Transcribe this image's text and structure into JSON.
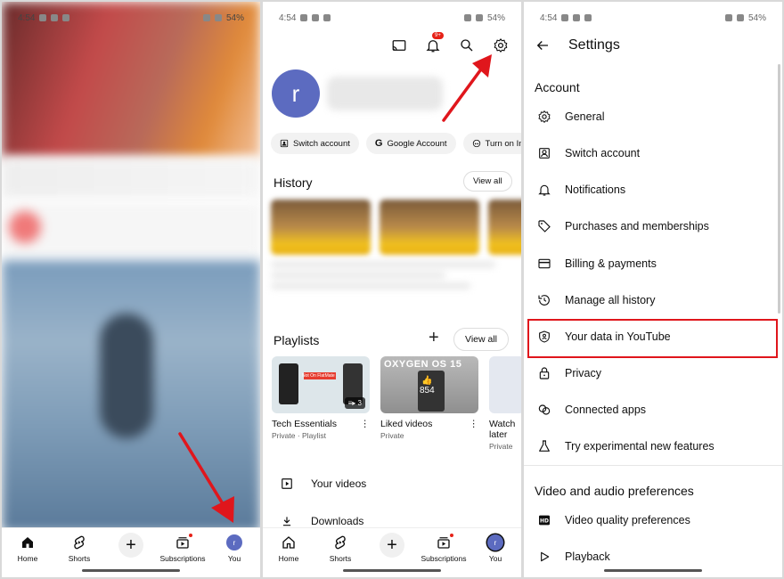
{
  "status_bar": {
    "time": "4:54",
    "battery": "54%"
  },
  "panel1": {
    "nav": [
      {
        "label": "Home",
        "icon": "home-icon"
      },
      {
        "label": "Shorts",
        "icon": "shorts-icon"
      },
      {
        "label": "",
        "icon": "plus-icon"
      },
      {
        "label": "Subscriptions",
        "icon": "subscriptions-icon"
      },
      {
        "label": "You",
        "icon": "avatar"
      }
    ]
  },
  "panel2": {
    "notification_badge": "9+",
    "avatar_letter": "r",
    "chips": [
      "Switch account",
      "Google Account",
      "Turn on Inc"
    ],
    "history": {
      "title": "History",
      "view_all": "View all"
    },
    "playlists": {
      "title": "Playlists",
      "view_all": "View all",
      "items": [
        {
          "title": "Tech Essentials",
          "sub": "Private · Playlist",
          "count": "3",
          "thumb_text": "Not On FlatMate"
        },
        {
          "title": "Liked videos",
          "sub": "Private",
          "likes": "854",
          "thumb_text": "OXYGEN OS 15"
        },
        {
          "title": "Watch later",
          "sub": "Private"
        }
      ]
    },
    "menu": [
      "Your videos",
      "Downloads"
    ],
    "nav": [
      {
        "label": "Home"
      },
      {
        "label": "Shorts"
      },
      {
        "label": ""
      },
      {
        "label": "Subscriptions"
      },
      {
        "label": "You"
      }
    ]
  },
  "panel3": {
    "title": "Settings",
    "account_header": "Account",
    "account_items": [
      {
        "label": "General",
        "icon": "gear-icon"
      },
      {
        "label": "Switch account",
        "icon": "switch-account-icon"
      },
      {
        "label": "Notifications",
        "icon": "bell-icon"
      },
      {
        "label": "Purchases and memberships",
        "icon": "tag-icon"
      },
      {
        "label": "Billing & payments",
        "icon": "card-icon"
      },
      {
        "label": "Manage all history",
        "icon": "history-icon"
      },
      {
        "label": "Your data in YouTube",
        "icon": "shield-person-icon"
      },
      {
        "label": "Privacy",
        "icon": "lock-icon"
      },
      {
        "label": "Connected apps",
        "icon": "connected-apps-icon"
      },
      {
        "label": "Try experimental new features",
        "icon": "flask-icon"
      }
    ],
    "video_header": "Video and audio preferences",
    "video_items": [
      {
        "label": "Video quality preferences",
        "icon": "hd-icon"
      },
      {
        "label": "Playback",
        "icon": "play-icon"
      }
    ]
  },
  "colors": {
    "highlight": "#e0161c",
    "avatar": "#5c6bc0",
    "arrow": "#e0161c"
  }
}
